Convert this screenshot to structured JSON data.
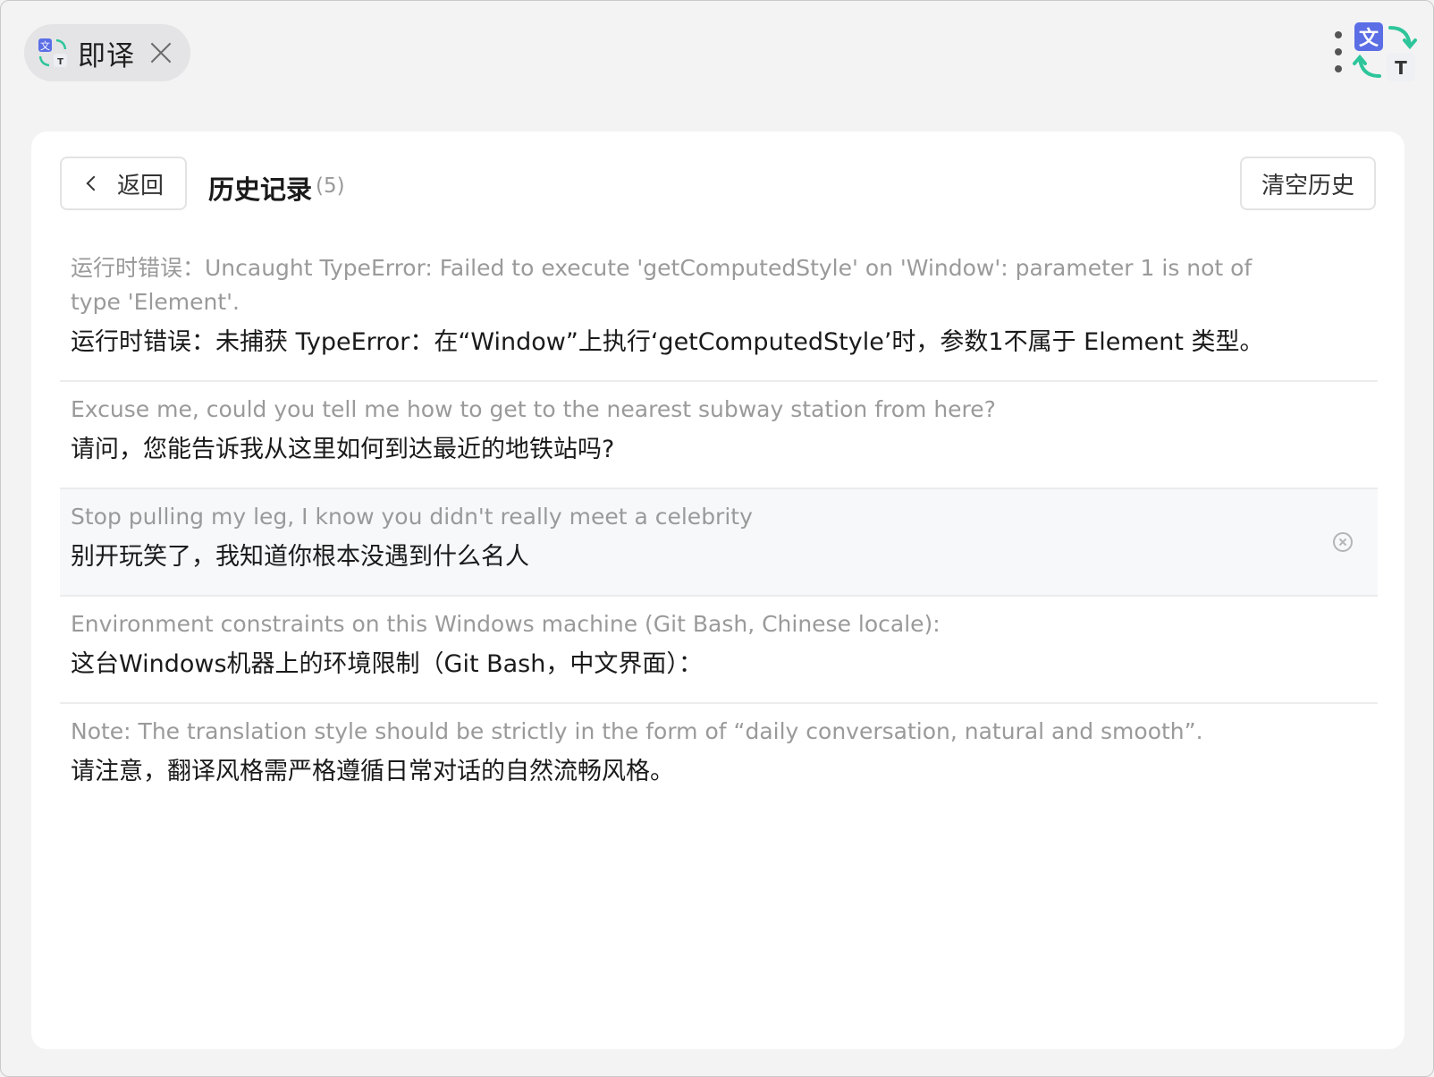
{
  "app": {
    "name": "即译",
    "logo_text": "文",
    "logo_text_small": "T"
  },
  "header": {
    "back_label": "返回",
    "title": "历史记录",
    "count": "(5)",
    "clear_label": "清空历史"
  },
  "history": [
    {
      "source": "运行时错误：Uncaught TypeError: Failed to execute 'getComputedStyle' on 'Window': parameter 1 is not of type 'Element'.",
      "translation": "运行时错误：未捕获 TypeError：在“Window”上执行‘getComputedStyle’时，参数1不属于 Element 类型。"
    },
    {
      "source": "Excuse me, could you tell me how to get to the nearest subway station from here?",
      "translation": "请问，您能告诉我从这里如何到达最近的地铁站吗?"
    },
    {
      "source": "Stop pulling my leg, I know you didn't really meet a celebrity",
      "translation": "别开玩笑了，我知道你根本没遇到什么名人"
    },
    {
      "source": "Environment constraints on this Windows machine (Git Bash, Chinese locale):",
      "translation": "这台Windows机器上的环境限制（Git Bash，中文界面）："
    },
    {
      "source": "Note: The translation style should be strictly in the form of “daily conversation, natural and smooth”.",
      "translation": "请注意，翻译风格需严格遵循日常对话的自然流畅风格。"
    }
  ],
  "colors": {
    "accent_blue": "#5b6ee6",
    "accent_green": "#2ec59b"
  }
}
